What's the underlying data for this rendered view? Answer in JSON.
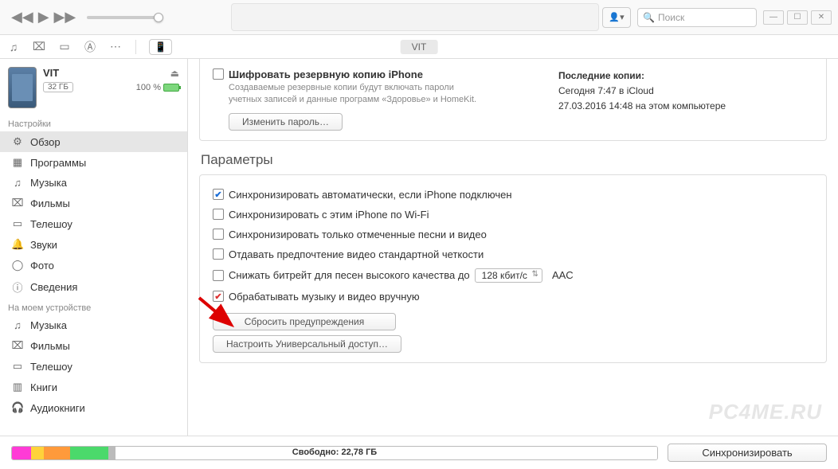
{
  "search_placeholder": "Поиск",
  "device_tab": "VIT",
  "device": {
    "name": "VIT",
    "capacity": "32 ГБ",
    "battery": "100 %"
  },
  "sidebar": {
    "group_settings": "Настройки",
    "group_ondevice": "На моем устройстве",
    "settings": [
      {
        "icon": "⚙",
        "label": "Обзор"
      },
      {
        "icon": "▦",
        "label": "Программы"
      },
      {
        "icon": "♫",
        "label": "Музыка"
      },
      {
        "icon": "⌧",
        "label": "Фильмы"
      },
      {
        "icon": "▭",
        "label": "Телешоу"
      },
      {
        "icon": "🔔",
        "label": "Звуки"
      },
      {
        "icon": "◯",
        "label": "Фото"
      },
      {
        "icon": "ⓘ",
        "label": "Сведения"
      }
    ],
    "ondevice": [
      {
        "icon": "♫",
        "label": "Музыка"
      },
      {
        "icon": "⌧",
        "label": "Фильмы"
      },
      {
        "icon": "▭",
        "label": "Телешоу"
      },
      {
        "icon": "▥",
        "label": "Книги"
      },
      {
        "icon": "🎧",
        "label": "Аудиокниги"
      }
    ]
  },
  "backup": {
    "encrypt_label": "Шифровать резервную копию iPhone",
    "encrypt_desc": "Создаваемые резервные копии будут включать пароли учетных записей и данные программ «Здоровье» и HomeKit.",
    "change_pw_btn": "Изменить пароль…",
    "last_title": "Последние копии:",
    "last_line1": "Сегодня 7:47 в iCloud",
    "last_line2": "27.03.2016 14:48 на этом компьютере"
  },
  "params": {
    "title": "Параметры",
    "opts": [
      {
        "checked": true,
        "red": false,
        "label": "Синхронизировать автоматически, если iPhone подключен"
      },
      {
        "checked": false,
        "red": false,
        "label": "Синхронизировать с этим iPhone по Wi-Fi"
      },
      {
        "checked": false,
        "red": false,
        "label": "Синхронизировать только отмеченные песни и видео"
      },
      {
        "checked": false,
        "red": false,
        "label": "Отдавать предпочтение видео стандартной четкости"
      },
      {
        "checked": false,
        "red": false,
        "label": "Снижать битрейт для песен высокого качества до"
      },
      {
        "checked": true,
        "red": true,
        "label": "Обрабатывать музыку и видео вручную"
      }
    ],
    "bitrate_value": "128 кбит/с",
    "aac_label": "AAC",
    "reset_warnings_btn": "Сбросить предупреждения",
    "universal_access_btn": "Настроить Универсальный доступ…"
  },
  "footer": {
    "free_label": "Свободно: 22,78 ГБ",
    "sync_btn": "Синхронизировать"
  },
  "watermark": "PC4ME.RU"
}
